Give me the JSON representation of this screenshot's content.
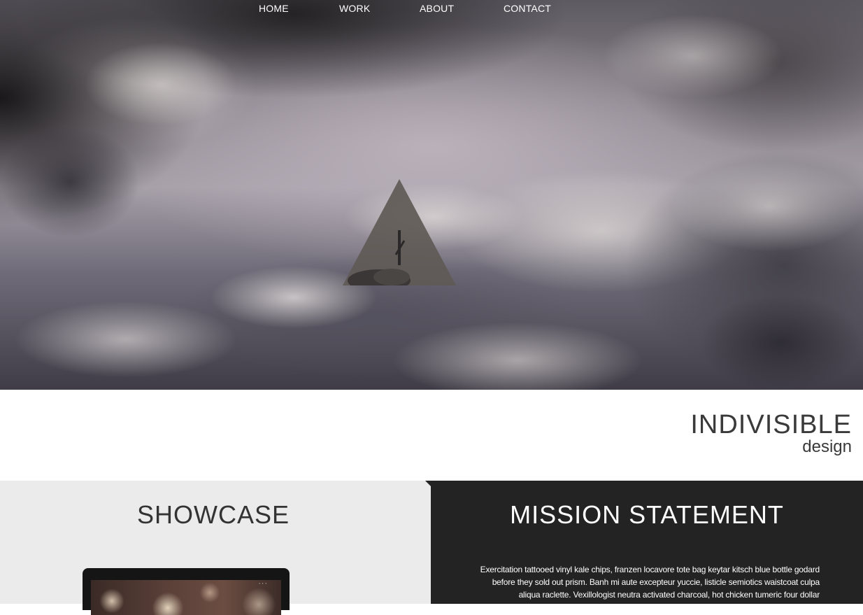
{
  "nav": {
    "items": [
      {
        "label": "HOME"
      },
      {
        "label": "WORK"
      },
      {
        "label": "ABOUT"
      },
      {
        "label": "CONTACT"
      }
    ]
  },
  "brand": {
    "name": "INDIVISIBLE",
    "tagline": "design"
  },
  "showcase": {
    "title": "SHOWCASE"
  },
  "mission": {
    "title": "MISSION STATEMENT",
    "body": "Exercitation tattooed vinyl kale chips, franzen locavore tote bag keytar kitsch blue bottle godard before they sold out prism. Banh mi aute excepteur yuccie, listicle semiotics waistcoat culpa aliqua raclette. Vexillologist neutra activated charcoal, hot chicken tumeric four dollar"
  },
  "colors": {
    "hero_triangle": "#5f5a56",
    "dark_panel": "#232323",
    "light_panel": "#ebebeb"
  }
}
